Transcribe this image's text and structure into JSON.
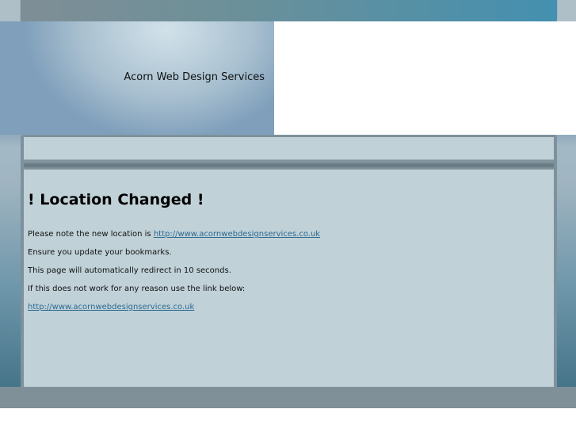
{
  "header": {
    "site_title": "Acorn Web Design Services"
  },
  "content": {
    "heading": "! Location Changed !",
    "line1_text": "Please note the new location is ",
    "line1_link": "http://www.acornwebdesignservices.co.uk",
    "line2": "Ensure you update your bookmarks.",
    "line3": "This page will automatically redirect in 10 seconds.",
    "line4": "If this does not work for any reason use the link below:",
    "link": "http://www.acornwebdesignservices.co.uk"
  }
}
